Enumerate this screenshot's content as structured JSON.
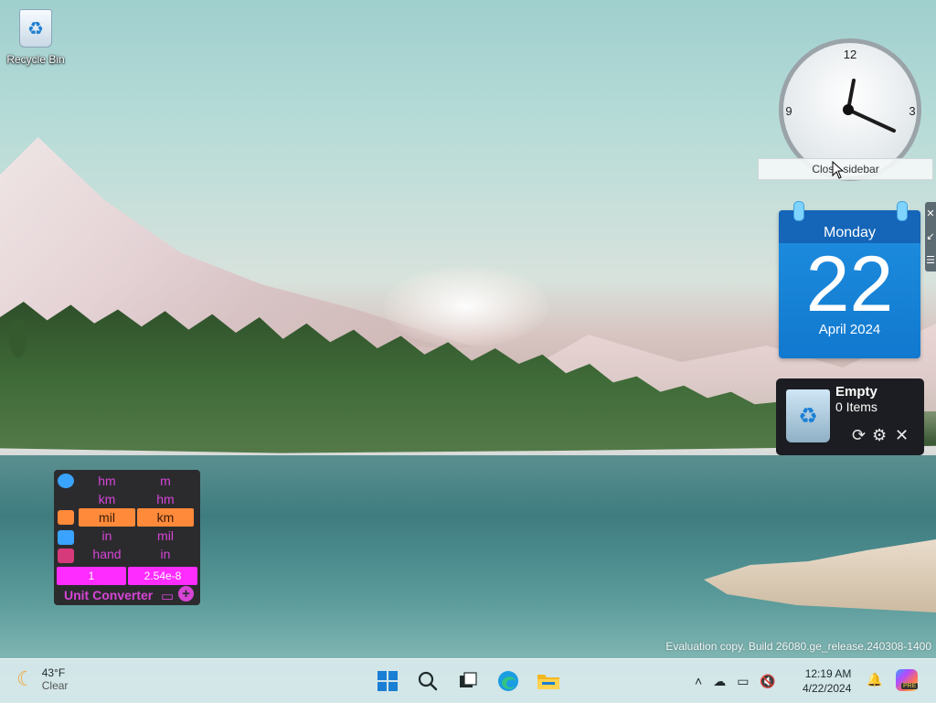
{
  "desktop": {
    "recycle_bin_label": "Recycle Bin",
    "watermark": "Evaluation copy. Build 26080.ge_release.240308-1400"
  },
  "clock_gadget": {
    "numerals": [
      "12",
      "3",
      "9"
    ],
    "time_shown": "12:19",
    "tooltip": "Close sidebar"
  },
  "side_controls": {
    "icons": [
      "close-icon",
      "shrink-icon",
      "menu-icon"
    ]
  },
  "calendar_gadget": {
    "day_name": "Monday",
    "day_number": "22",
    "month_year": "April 2024",
    "accent": "#1a7fd4"
  },
  "recycle_bin_gadget": {
    "title": "Empty",
    "count": "0 Items"
  },
  "unit_converter": {
    "title": "Unit Converter",
    "rows": [
      {
        "left": "hm",
        "right": "m"
      },
      {
        "left": "km",
        "right": "hm"
      },
      {
        "left": "mil",
        "right": "km",
        "selected": true
      },
      {
        "left": "in",
        "right": "mil"
      },
      {
        "left": "hand",
        "right": "in"
      }
    ],
    "input_value": "1",
    "output_value": "2.54e-8",
    "accent": "#ff2cff",
    "selected_color": "#ff8a3a"
  },
  "taskbar": {
    "weather_temp": "43°F",
    "weather_condition": "Clear",
    "time": "12:19 AM",
    "date": "4/22/2024",
    "copilot_badge": "PRE"
  }
}
